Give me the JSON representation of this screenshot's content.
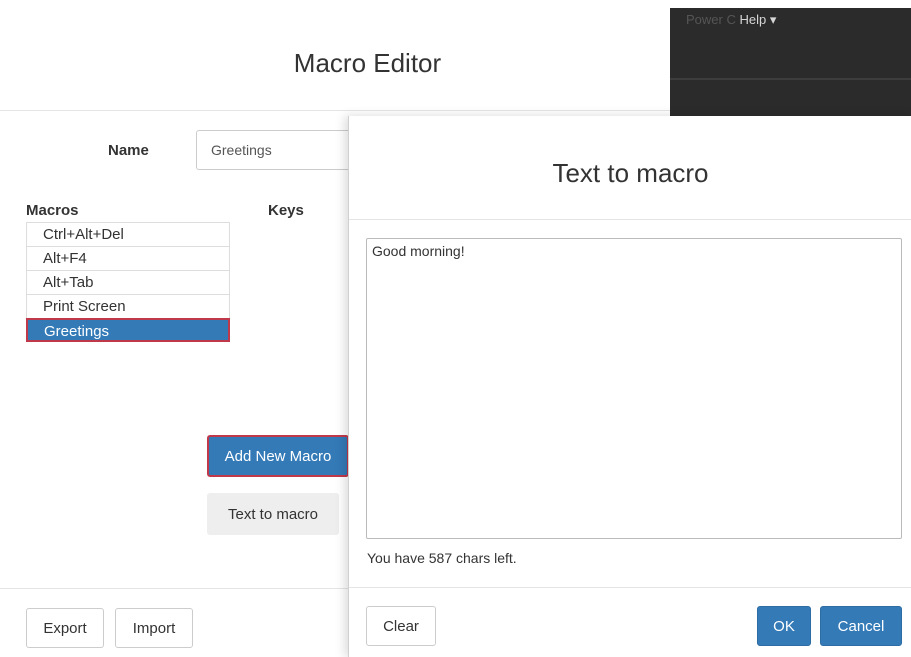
{
  "app": {
    "title": "Macro Editor",
    "menu_partial": "Power C",
    "menu_help": "Help ▾"
  },
  "editor": {
    "name_label": "Name",
    "name_value": "Greetings",
    "macros_label": "Macros",
    "keys_label": "Keys",
    "macros": [
      {
        "label": "Ctrl+Alt+Del",
        "selected": false
      },
      {
        "label": "Alt+F4",
        "selected": false
      },
      {
        "label": "Alt+Tab",
        "selected": false
      },
      {
        "label": "Print Screen",
        "selected": false
      },
      {
        "label": "Greetings",
        "selected": true
      }
    ],
    "add_new_macro_label": "Add New Macro",
    "text_to_macro_label": "Text to macro",
    "export_label": "Export",
    "import_label": "Import"
  },
  "modal": {
    "title": "Text to macro",
    "text_value": "Good morning!",
    "chars_left_text": "You have 587 chars left.",
    "clear_label": "Clear",
    "ok_label": "OK",
    "cancel_label": "Cancel"
  },
  "colors": {
    "primary": "#337ab7",
    "highlight_border": "#c0394b",
    "dark_bar": "#2b2b2b"
  }
}
